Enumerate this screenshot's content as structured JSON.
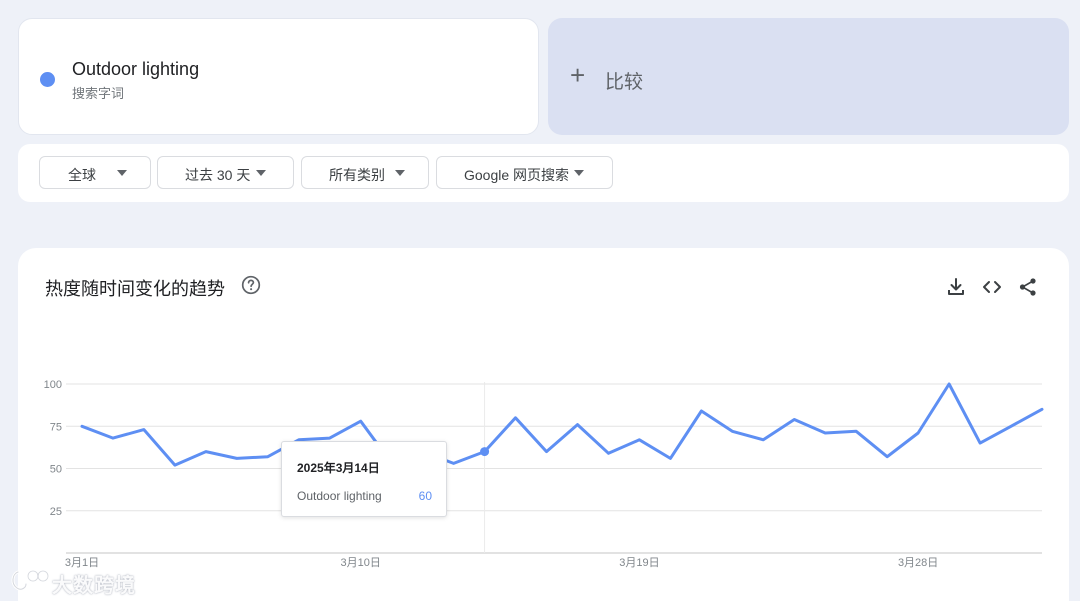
{
  "term": {
    "name": "Outdoor lighting",
    "type_label": "搜索字词",
    "color": "#5e8ff3"
  },
  "compare": {
    "plus": "+",
    "label": "比较"
  },
  "filters": [
    {
      "label": "全球"
    },
    {
      "label": "过去 30 天"
    },
    {
      "label": "所有类别"
    },
    {
      "label": "Google 网页搜索"
    }
  ],
  "chart": {
    "title": "热度随时间变化的趋势",
    "icons": [
      "help-icon",
      "download-icon",
      "embed-icon",
      "share-icon"
    ]
  },
  "tooltip": {
    "date": "2025年3月14日",
    "term": "Outdoor lighting",
    "value": "60"
  },
  "watermark": {
    "text": "大数跨境"
  },
  "chart_data": {
    "type": "line",
    "title": "热度随时间变化的趋势",
    "ylim": [
      0,
      100
    ],
    "yticks": [
      25,
      50,
      75,
      100
    ],
    "xtick_labels": [
      "3月1日",
      "3月10日",
      "3月19日",
      "3月28日"
    ],
    "xtick_indices": [
      0,
      9,
      18,
      27
    ],
    "highlight_index": 13,
    "series": [
      {
        "name": "Outdoor lighting",
        "color": "#5e8ff3",
        "dates": [
          "3月1日",
          "3月2日",
          "3月3日",
          "3月4日",
          "3月5日",
          "3月6日",
          "3月7日",
          "3月8日",
          "3月9日",
          "3月10日",
          "3月11日",
          "3月12日",
          "3月13日",
          "3月14日",
          "3月15日",
          "3月16日",
          "3月17日",
          "3月18日",
          "3月19日",
          "3月20日",
          "3月21日",
          "3月22日",
          "3月23日",
          "3月24日",
          "3月25日",
          "3月26日",
          "3月27日",
          "3月28日",
          "3月29日",
          "3月30日",
          "3月31日"
        ],
        "values": [
          75,
          68,
          73,
          52,
          60,
          56,
          57,
          67,
          68,
          78,
          53,
          60,
          53,
          60,
          80,
          60,
          76,
          59,
          67,
          56,
          84,
          72,
          67,
          79,
          71,
          72,
          57,
          71,
          100,
          65,
          75,
          85
        ]
      }
    ]
  }
}
